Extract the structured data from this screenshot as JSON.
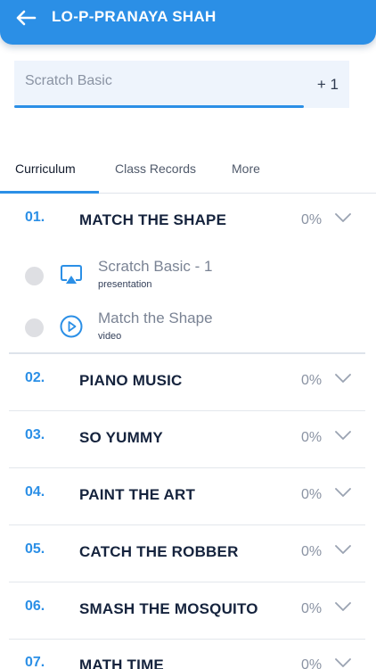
{
  "header": {
    "title": "LO-P-PRANAYA SHAH",
    "back_icon": "arrow-left-icon",
    "color": "#2b8fe6"
  },
  "selector": {
    "value": "Scratch Basic",
    "extra_count": "+ 1"
  },
  "tabs": [
    {
      "label": "Curriculum",
      "active": true
    },
    {
      "label": "Class Records",
      "active": false
    },
    {
      "label": "More",
      "active": false
    }
  ],
  "sections": [
    {
      "num": "01.",
      "title": "MATCH THE SHAPE",
      "progress": "0%",
      "lessons": [
        {
          "title": "Scratch Basic - 1",
          "type": "presentation",
          "icon": "presentation-icon"
        },
        {
          "title": "Match the Shape",
          "type": "video",
          "icon": "play-circle-icon"
        }
      ]
    },
    {
      "num": "02.",
      "title": "PIANO MUSIC",
      "progress": "0%"
    },
    {
      "num": "03.",
      "title": "SO YUMMY",
      "progress": "0%"
    },
    {
      "num": "04.",
      "title": "PAINT THE ART",
      "progress": "0%"
    },
    {
      "num": "05.",
      "title": "CATCH THE ROBBER",
      "progress": "0%"
    },
    {
      "num": "06.",
      "title": "SMASH THE MOSQUITO",
      "progress": "0%"
    },
    {
      "num": "07.",
      "title": "MATH TIME",
      "progress": "0%"
    }
  ]
}
